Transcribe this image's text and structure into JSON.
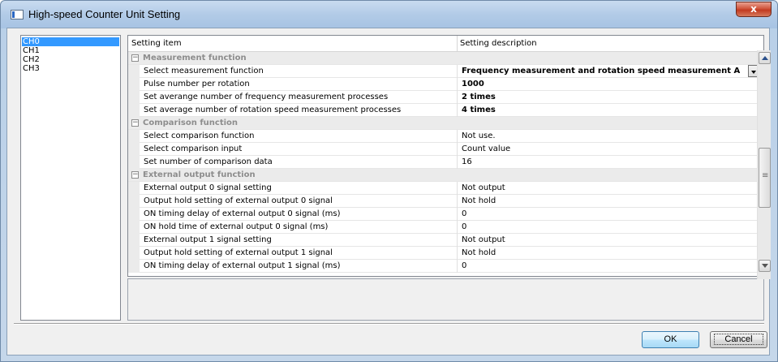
{
  "window": {
    "title": "High-speed Counter Unit Setting",
    "close_label": "x"
  },
  "channels": [
    "CH0",
    "CH1",
    "CH2",
    "CH3"
  ],
  "grid": {
    "header_item": "Setting item",
    "header_desc": "Setting description",
    "rows": [
      {
        "type": "group",
        "name": "Measurement function",
        "value": ""
      },
      {
        "type": "item",
        "name": "Select measurement function",
        "value": "Frequency measurement and rotation speed measurement A",
        "bold": true,
        "combo": true
      },
      {
        "type": "item",
        "name": "Pulse number per rotation",
        "value": "1000",
        "bold": true
      },
      {
        "type": "item",
        "name": "Set averange number of frequency measurement processes",
        "value": "2 times",
        "bold": true
      },
      {
        "type": "item",
        "name": "Set average number of rotation speed measurement processes",
        "value": "4 times",
        "bold": true
      },
      {
        "type": "group",
        "name": "Comparison function",
        "value": ""
      },
      {
        "type": "item",
        "name": "Select comparison function",
        "value": "Not use."
      },
      {
        "type": "item",
        "name": "Select comparison input",
        "value": "Count value"
      },
      {
        "type": "item",
        "name": "Set number of comparison data",
        "value": "16"
      },
      {
        "type": "group",
        "name": "External output function",
        "value": ""
      },
      {
        "type": "item",
        "name": "External output 0 signal setting",
        "value": "Not output"
      },
      {
        "type": "item",
        "name": "Output hold setting of external output 0 signal",
        "value": "Not hold"
      },
      {
        "type": "item",
        "name": "ON timing delay of external output 0 signal (ms)",
        "value": "0"
      },
      {
        "type": "item",
        "name": "ON hold time of external output 0 signal (ms)",
        "value": "0"
      },
      {
        "type": "item",
        "name": "External output 1 signal setting",
        "value": "Not output"
      },
      {
        "type": "item",
        "name": "Output hold setting of external output 1 signal",
        "value": "Not hold"
      },
      {
        "type": "item",
        "name": "ON timing delay of external output 1 signal (ms)",
        "value": "0"
      }
    ]
  },
  "buttons": {
    "ok": "OK",
    "cancel": "Cancel"
  },
  "icons": {
    "window_icon": "window-icon",
    "expander": "collapse-icon",
    "combo": "chevron-down-icon"
  }
}
